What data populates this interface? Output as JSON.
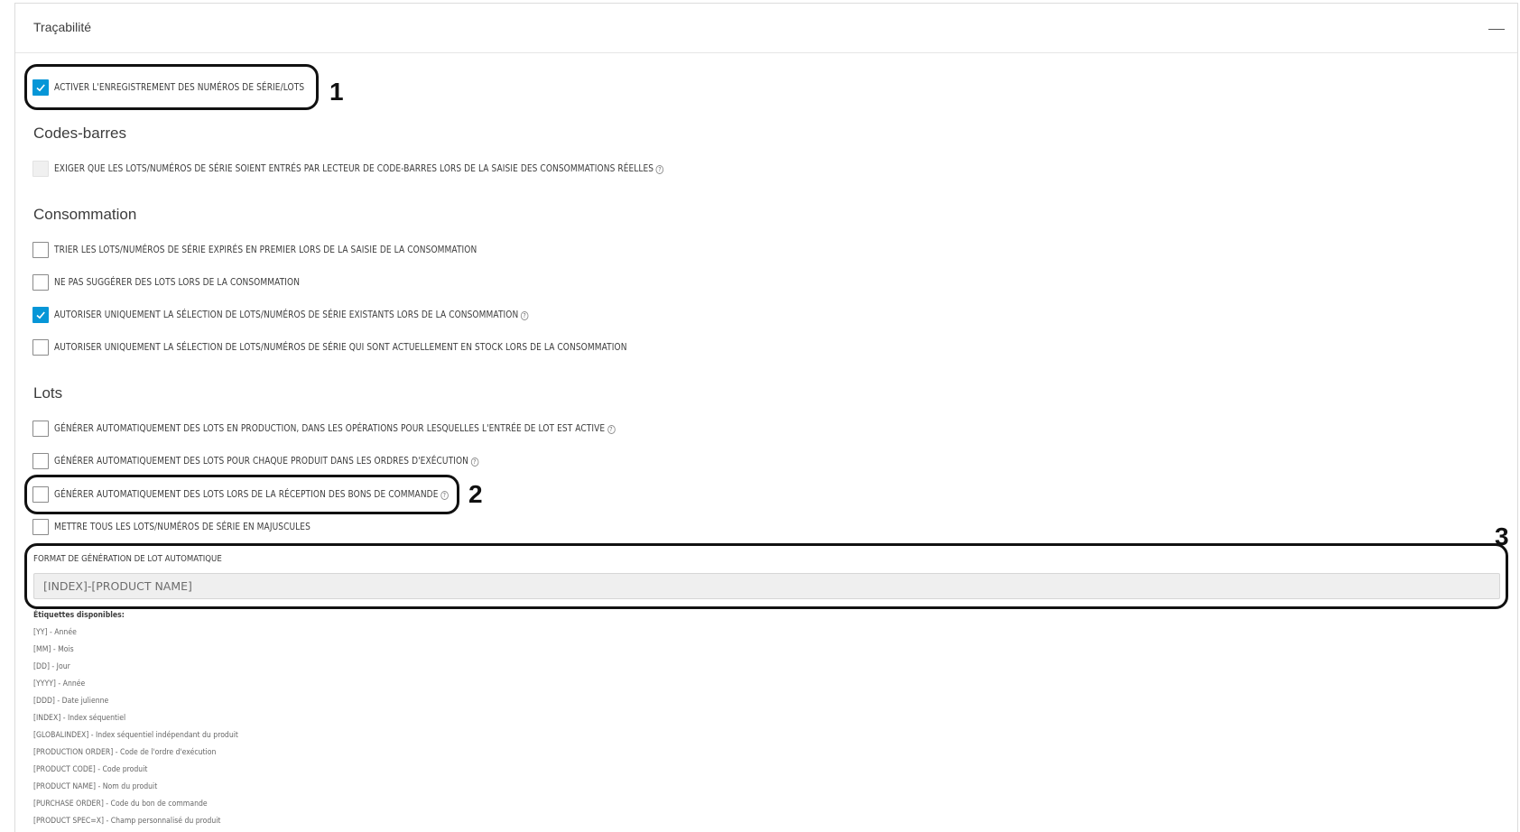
{
  "panel": {
    "title": "Traçabilité",
    "collapse_icon": "minus-icon"
  },
  "enable_serials": {
    "label": "ACTIVER L'ENREGISTREMENT DES NUMÉROS DE SÉRIE/LOTS",
    "checked": true
  },
  "sections": {
    "barcodes": "Codes-barres",
    "consumption": "Consommation",
    "lots": "Lots"
  },
  "barcodes_options": {
    "require_scan": "EXIGER QUE LES LOTS/NUMÉROS DE SÉRIE SOIENT ENTRÉS PAR LECTEUR DE CODE-BARRES LORS DE LA SAISIE DES CONSOMMATIONS RÉELLES"
  },
  "consumption_options": {
    "sort_expired": "TRIER LES LOTS/NUMÉROS DE SÉRIE EXPIRÉS EN PREMIER LORS DE LA SAISIE DE LA CONSOMMATION",
    "no_suggest": "NE PAS SUGGÉRER DES LOTS LORS DE LA CONSOMMATION",
    "only_existing": "AUTORISER UNIQUEMENT LA SÉLECTION DE LOTS/NUMÉROS DE SÉRIE EXISTANTS LORS DE LA CONSOMMATION",
    "only_in_stock": "AUTORISER UNIQUEMENT LA SÉLECTION DE LOTS/NUMÉROS DE SÉRIE QUI SONT ACTUELLEMENT EN STOCK LORS DE LA CONSOMMATION"
  },
  "lots_options": {
    "auto_production": "GÉNÉRER AUTOMATIQUEMENT DES LOTS EN PRODUCTION, DANS LES OPÉRATIONS POUR LESQUELLES L'ENTRÉE DE LOT EST ACTIVE",
    "auto_per_product": "GÉNÉRER AUTOMATIQUEMENT DES LOTS POUR CHAQUE PRODUIT DANS LES ORDRES D'EXÉCUTION",
    "auto_purchase": "GÉNÉRER AUTOMATIQUEMENT DES LOTS LORS DE LA RÉCEPTION DES BONS DE COMMANDE",
    "uppercase": "METTRE TOUS LES LOTS/NUMÉROS DE SÉRIE EN MAJUSCULES"
  },
  "format": {
    "label": "FORMAT DE GÉNÉRATION DE LOT AUTOMATIQUE",
    "value": "[INDEX]-[PRODUCT NAME]"
  },
  "tags": {
    "title": "Étiquettes disponibles:",
    "items": [
      "[YY] - Année",
      "[MM] - Mois",
      "[DD] - Jour",
      "[YYYY] - Année",
      "[DDD] - Date julienne",
      "[INDEX] - Index séquentiel",
      "[GLOBALINDEX] - Index séquentiel indépendant du produit",
      "[PRODUCTION ORDER] - Code de l'ordre d'exécution",
      "[PRODUCT CODE] - Code produit",
      "[PRODUCT NAME] - Nom du produit",
      "[PURCHASE ORDER] - Code du bon de commande",
      "[PRODUCT SPEC=X] - Champ personnalisé du produit"
    ]
  },
  "callouts": [
    "1",
    "2",
    "3"
  ],
  "help_icon": "?",
  "accent_color": "#0696d7"
}
